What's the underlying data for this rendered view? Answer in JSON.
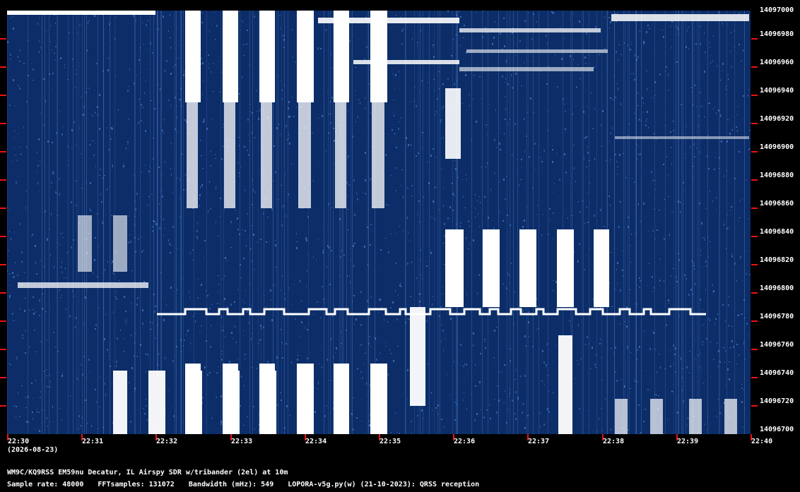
{
  "y_axis": {
    "labels": [
      "14097000",
      "14096980",
      "14096960",
      "14096940",
      "14096920",
      "14096900",
      "14096880",
      "14096860",
      "14096840",
      "14096820",
      "14096800",
      "14096780",
      "14096760",
      "14096740",
      "14096720",
      "14096700"
    ]
  },
  "x_axis": {
    "labels": [
      "22:30",
      "22:31",
      "22:32",
      "22:33",
      "22:34",
      "22:35",
      "22:36",
      "22:37",
      "22:38",
      "22:39",
      "22:40"
    ],
    "date": "(2026-08-23)"
  },
  "footer": {
    "station": "WM9C/KQ9RSS EM59nu Decatur, IL  Airspy SDR w/tribander (2el) at 10m",
    "sample_rate": "Sample rate: 48000",
    "fft_samples": "FFTsamples: 131072",
    "bandwidth": "Bandwidth (mHz): 549",
    "software": "LOPORA-v5g.py(w) (21-10-2023): QRSS reception"
  },
  "colors": {
    "background": "#000000",
    "waterfall": "#0c2d68",
    "signal": "#ffffff",
    "ticks": "#ee1111"
  }
}
